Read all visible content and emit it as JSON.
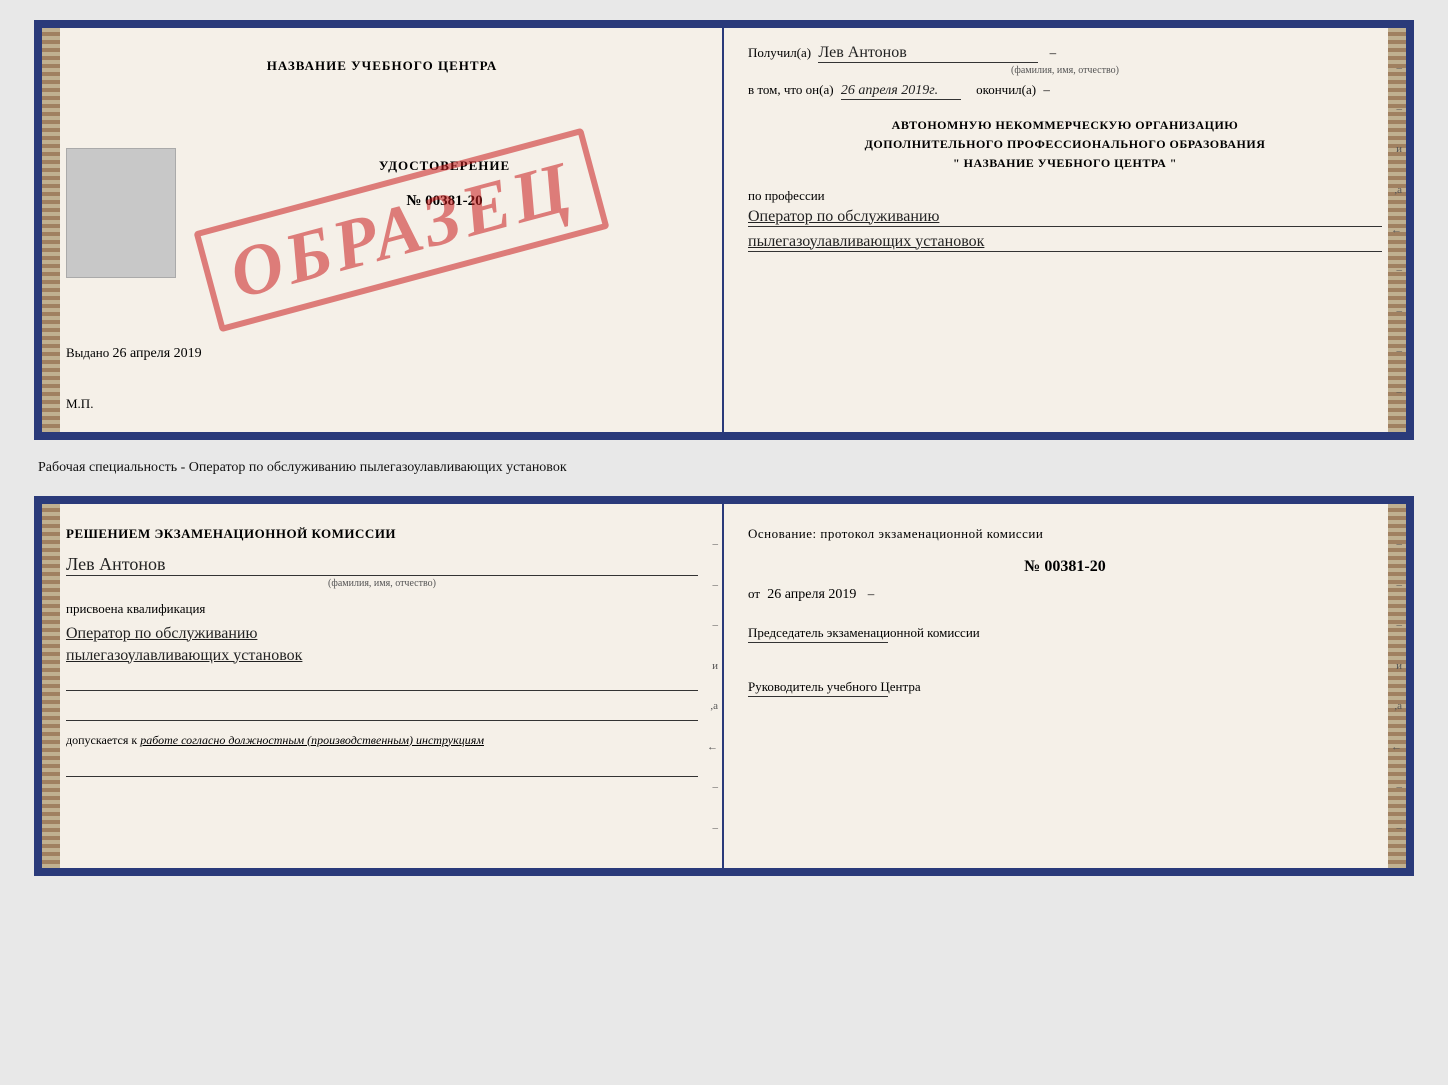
{
  "page": {
    "background": "#e8e8e8"
  },
  "cert_top": {
    "left": {
      "title": "НАЗВАНИЕ УЧЕБНОГО ЦЕНТРА",
      "doc_title": "УДОСТОВЕРЕНИЕ",
      "doc_number": "№ 00381-20",
      "vydano_label": "Выдано",
      "vydano_date": "26 апреля 2019",
      "mp_label": "М.П.",
      "stamp": "ОБРАЗЕЦ"
    },
    "right": {
      "poluchil_label": "Получил(а)",
      "poluchil_name": "Лев Антонов",
      "fio_sublabel": "(фамилия, имя, отчество)",
      "v_tom_label": "в том, что он(а)",
      "v_tom_date": "26 апреля 2019г.",
      "okonchil_label": "окончил(а)",
      "org_line1": "АВТОНОМНУЮ НЕКОММЕРЧЕСКУЮ ОРГАНИЗАЦИЮ",
      "org_line2": "ДОПОЛНИТЕЛЬНОГО ПРОФЕССИОНАЛЬНОГО ОБРАЗОВАНИЯ",
      "org_line3": "\"  НАЗВАНИЕ УЧЕБНОГО ЦЕНТРА  \"",
      "po_professii_label": "по профессии",
      "profession_line1": "Оператор по обслуживанию",
      "profession_line2": "пылегазоулавливающих установок"
    }
  },
  "subtitle": "Рабочая специальность - Оператор по обслуживанию пылегазоулавливающих установок",
  "cert_bottom": {
    "left": {
      "resheniyem_label": "Решением экзаменационной комиссии",
      "name_hw": "Лев Антонов",
      "fio_sublabel": "(фамилия, имя, отчество)",
      "prisvoena_label": "присвоена квалификация",
      "qualification_line1": "Оператор по обслуживанию",
      "qualification_line2": "пылегазоулавливающих установок",
      "dopusk_label": "допускается к",
      "dopusk_text": "работе согласно должностным (производственным) инструкциям"
    },
    "right": {
      "osnovanie_label": "Основание: протокол экзаменационной комиссии",
      "protocol_num": "№  00381-20",
      "ot_label": "от",
      "ot_date": "26 апреля 2019",
      "predsedatel_label": "Председатель экзаменационной комиссии",
      "rukovoditel_label": "Руководитель учебного Центра"
    }
  }
}
